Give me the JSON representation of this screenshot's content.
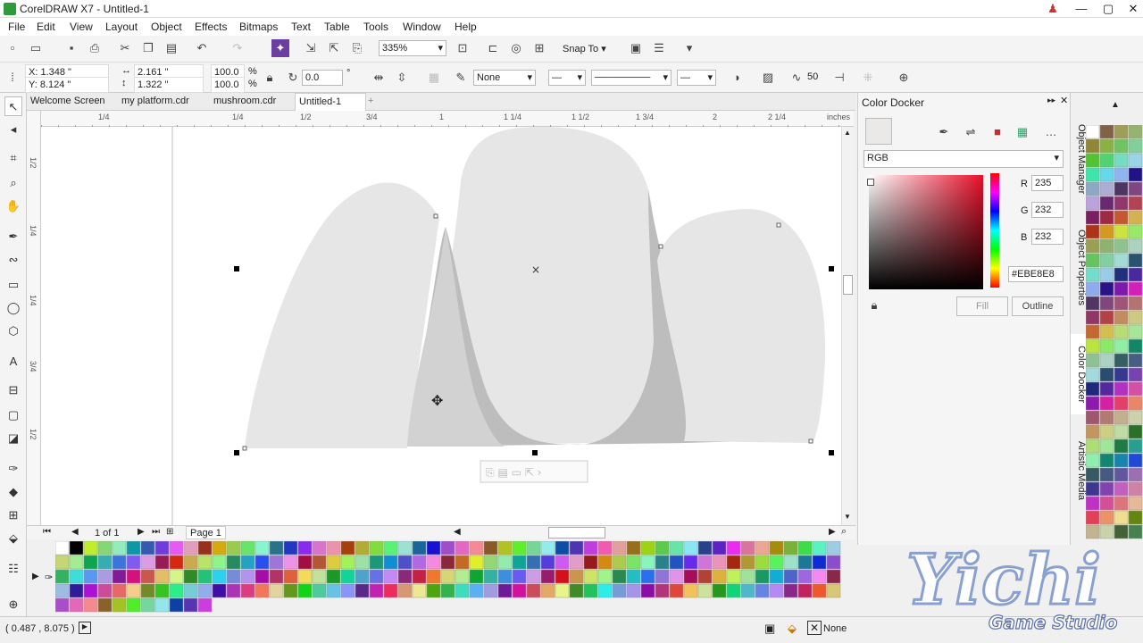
{
  "window": {
    "title": "CorelDRAW X7 - Untitled-1",
    "min_label": "—",
    "max_label": "▢",
    "close_label": "✕"
  },
  "menu": [
    "File",
    "Edit",
    "View",
    "Layout",
    "Object",
    "Effects",
    "Bitmaps",
    "Text",
    "Table",
    "Tools",
    "Window",
    "Help"
  ],
  "standard_toolbar": {
    "zoom": "335%",
    "snap_to": "Snap To"
  },
  "property_bar": {
    "x": "X: 1.348 \"",
    "y": "Y: 8.124 \"",
    "w": "2.161 \"",
    "h": "1.322 \"",
    "sx": "100.0",
    "sy": "100.0",
    "pct": "%",
    "rotation": "0.0",
    "degree": "°",
    "outline_none": "None",
    "smooth": "50"
  },
  "doc_tabs": [
    "Welcome Screen",
    "my platform.cdr",
    "mushroom.cdr",
    "Untitled-1"
  ],
  "ruler": {
    "unit": "inches",
    "h_ticks": [
      "1/4",
      "1/4",
      "1/2",
      "3/4",
      "1",
      "1 1/4",
      "1 1/2",
      "1 3/4",
      "2",
      "2 1/4"
    ],
    "v_ticks": [
      "1/2",
      "1/4",
      "1/4",
      "3/4",
      "1/2"
    ]
  },
  "page_nav": {
    "count": "1 of 1",
    "page_tab": "Page 1"
  },
  "color_docker": {
    "title": "Color Docker",
    "model": "RGB",
    "r_label": "R",
    "g_label": "G",
    "b_label": "B",
    "r": "235",
    "g": "232",
    "b": "232",
    "hex": "#EBE8E8",
    "fill_button": "Fill",
    "outline_button": "Outline",
    "swatch_color": "#ebe8e8"
  },
  "side_tabs": [
    "Object Manager",
    "Object Properties",
    "Color Docker",
    "Artistic Media"
  ],
  "status": {
    "coords": "( 0.487 , 8.075 )",
    "fill_none": "None"
  },
  "shapes": {
    "light": "#e6e6e6",
    "mid": "#d2d2d2",
    "dark": "#bdbdbd"
  },
  "watermark": {
    "text": "Yichi",
    "sub": "Game Studio"
  }
}
